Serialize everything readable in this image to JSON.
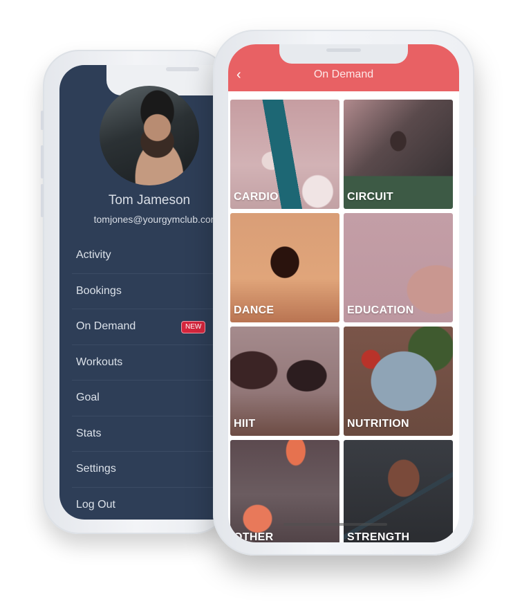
{
  "drawer_phone": {
    "profile": {
      "name": "Tom Jameson",
      "email": "tomjones@yourgymclub.com"
    },
    "menu": [
      {
        "label": "Activity"
      },
      {
        "label": "Bookings"
      },
      {
        "label": "On Demand",
        "badge": "NEW"
      },
      {
        "label": "Workouts"
      },
      {
        "label": "Goal"
      },
      {
        "label": "Stats"
      },
      {
        "label": "Settings"
      },
      {
        "label": "Log Out"
      }
    ]
  },
  "on_demand_phone": {
    "header": {
      "title": "On Demand",
      "back_icon": "‹"
    },
    "categories": [
      {
        "label": "CARDIO"
      },
      {
        "label": "CIRCUIT"
      },
      {
        "label": "DANCE"
      },
      {
        "label": "EDUCATION"
      },
      {
        "label": "HIIT"
      },
      {
        "label": "NUTRITION"
      },
      {
        "label": "OTHER"
      },
      {
        "label": "STRENGTH"
      }
    ]
  },
  "colors": {
    "drawer_bg": "#2e3e57",
    "header_accent": "#e86164",
    "badge_red": "#d6263d"
  }
}
